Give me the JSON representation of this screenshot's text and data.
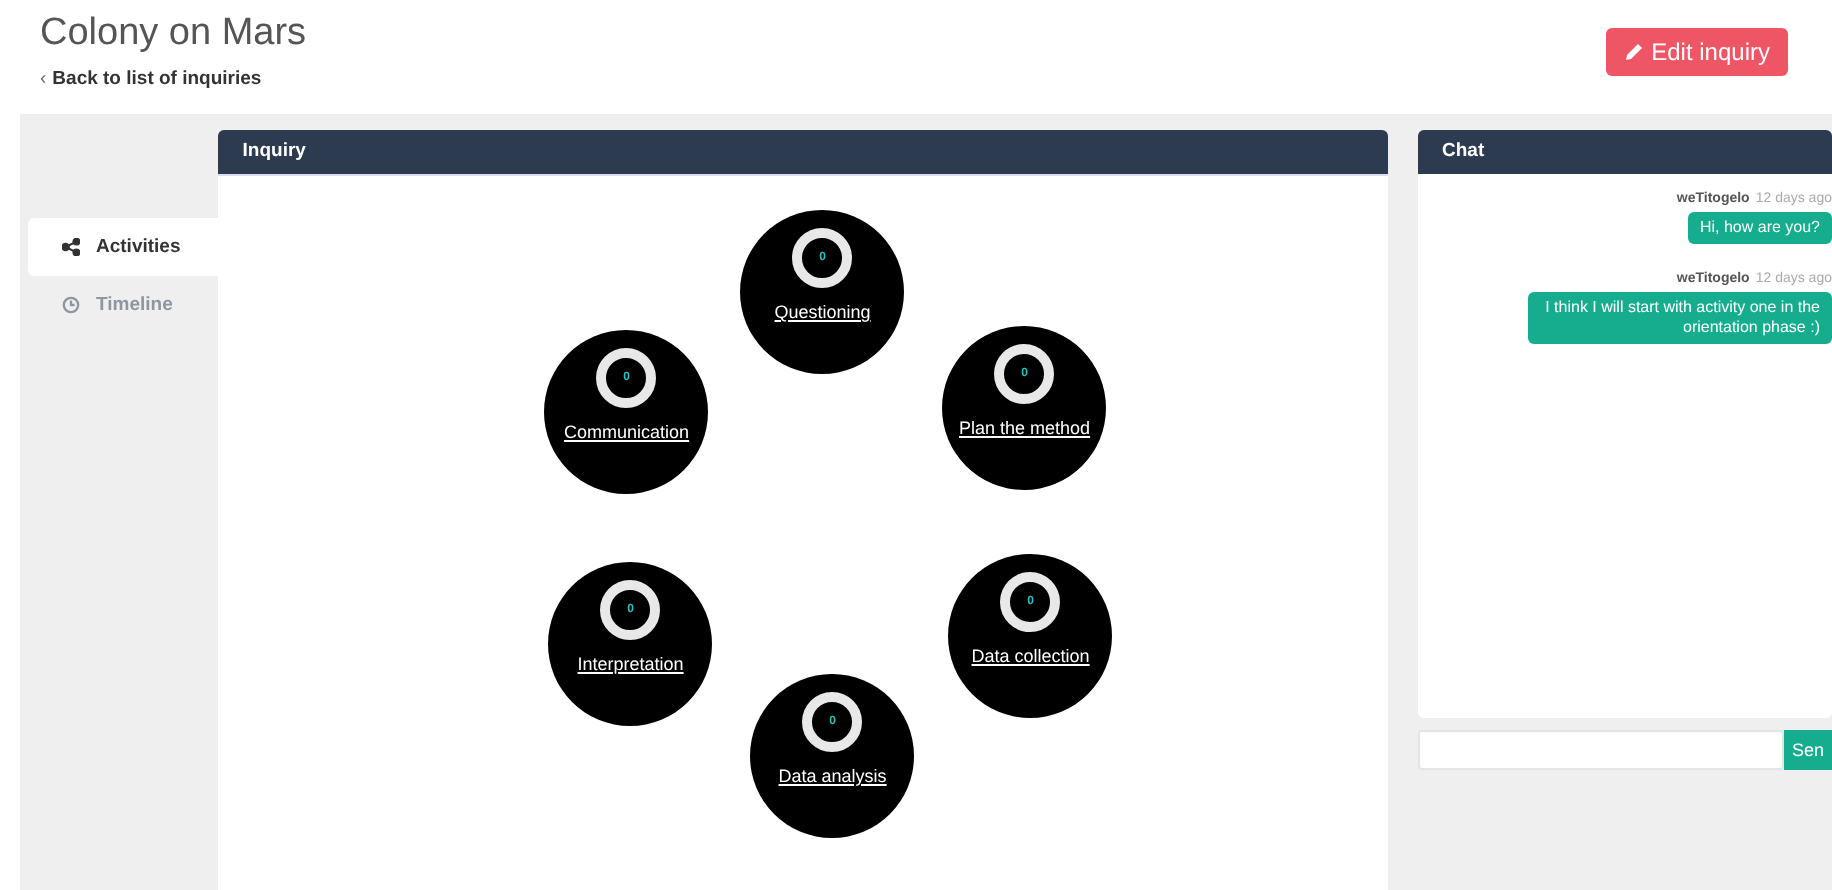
{
  "title": "Colony on Mars",
  "back_icon": "‹",
  "back_link": "Back to list of inquiries",
  "edit_button": "Edit inquiry",
  "tabs": [
    {
      "label": "Activities",
      "selected": true
    },
    {
      "label": "Timeline",
      "selected": false
    }
  ],
  "inquiry": {
    "title": "Inquiry",
    "phases": [
      {
        "name": "Questioning",
        "count": "0"
      },
      {
        "name": "Communication",
        "count": "0"
      },
      {
        "name": "Plan the method",
        "count": "0"
      },
      {
        "name": "Interpretation",
        "count": "0"
      },
      {
        "name": "Data collection",
        "count": "0"
      },
      {
        "name": "Data analysis",
        "count": "0"
      }
    ]
  },
  "chat": {
    "title": "Chat",
    "messages": [
      {
        "author": "weTitogelo",
        "time": "12 days ago",
        "text": "Hi, how are you?"
      },
      {
        "author": "weTitogelo",
        "time": "12 days ago",
        "text": "I think I will start with activity one in the orientation phase :)"
      }
    ],
    "send_button": "Sen"
  }
}
